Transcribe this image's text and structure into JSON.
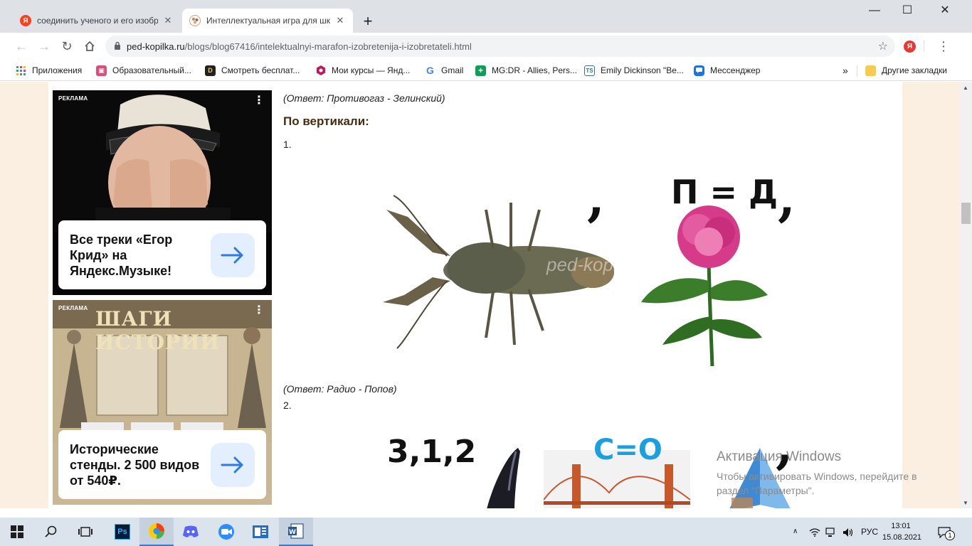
{
  "browser": {
    "tabs": [
      {
        "title": "соединить ученого и его изобр",
        "active": false,
        "favicon": "yandex-icon"
      },
      {
        "title": "Интеллектуальная игра для шко",
        "active": true,
        "favicon": "ped-kopilka-icon"
      }
    ],
    "new_tab": "+",
    "window": {
      "minimize": "—",
      "maximize": "☐",
      "close": "✕"
    },
    "url_host": "ped-kopilka.ru",
    "url_path": "/blogs/blog67416/intelektualnyi-marafon-izobretenija-i-izobretateli.html",
    "bookmarks": [
      {
        "label": "Приложения",
        "icon": "apps-grid-icon",
        "color": "#4285f4"
      },
      {
        "label": "Образовательный...",
        "icon": "image-icon",
        "color": "#d94f7a"
      },
      {
        "label": "Смотреть бесплат...",
        "icon": "d-logo-icon",
        "color": "#222222"
      },
      {
        "label": "Мои курсы — Янд...",
        "icon": "hexagon-icon",
        "color": "#c2185b"
      },
      {
        "label": "Gmail",
        "icon": "google-icon",
        "color": "#4285f4"
      },
      {
        "label": "MG:DR - Allies, Pers...",
        "icon": "plus-icon",
        "color": "#0f9d58"
      },
      {
        "label": "Emily Dickinson \"Be...",
        "icon": "ts-icon",
        "color": "#3d6f8e"
      },
      {
        "label": "Мессенджер",
        "icon": "messenger-icon",
        "color": "#1a73e8"
      }
    ],
    "bookmarks_more": "»",
    "other_bookmarks": "Другие закладки"
  },
  "ads": [
    {
      "label": "РЕКЛАМА",
      "text": "Все треки «Егор Крид» на Яндекс.Музыке!"
    },
    {
      "label": "РЕКЛАМА",
      "banner": "ШАГИ ИСТОРИИ",
      "text": "Исторические стенды. 2 500 видов от 540₽."
    }
  ],
  "article": {
    "answer1": "(Ответ: Противогаз - Зелинский)",
    "heading_vertical": "По вертикали:",
    "item1": "1.",
    "rebus1_text": "П = Д",
    "watermark": "ped-kopilka.ru",
    "answer2": "(Ответ: Радио - Попов)",
    "item2": "2.",
    "rebus2_num": "3,1,2",
    "rebus2_eq": "С=О"
  },
  "activation": {
    "title": "Активация Windows",
    "line1": "Чтобы активировать Windows, перейдите в",
    "line2": "раздел \"Параметры\"."
  },
  "taskbar": {
    "lang": "РУС",
    "time": "13:01",
    "date": "15.08.2021",
    "notifications": "1"
  }
}
